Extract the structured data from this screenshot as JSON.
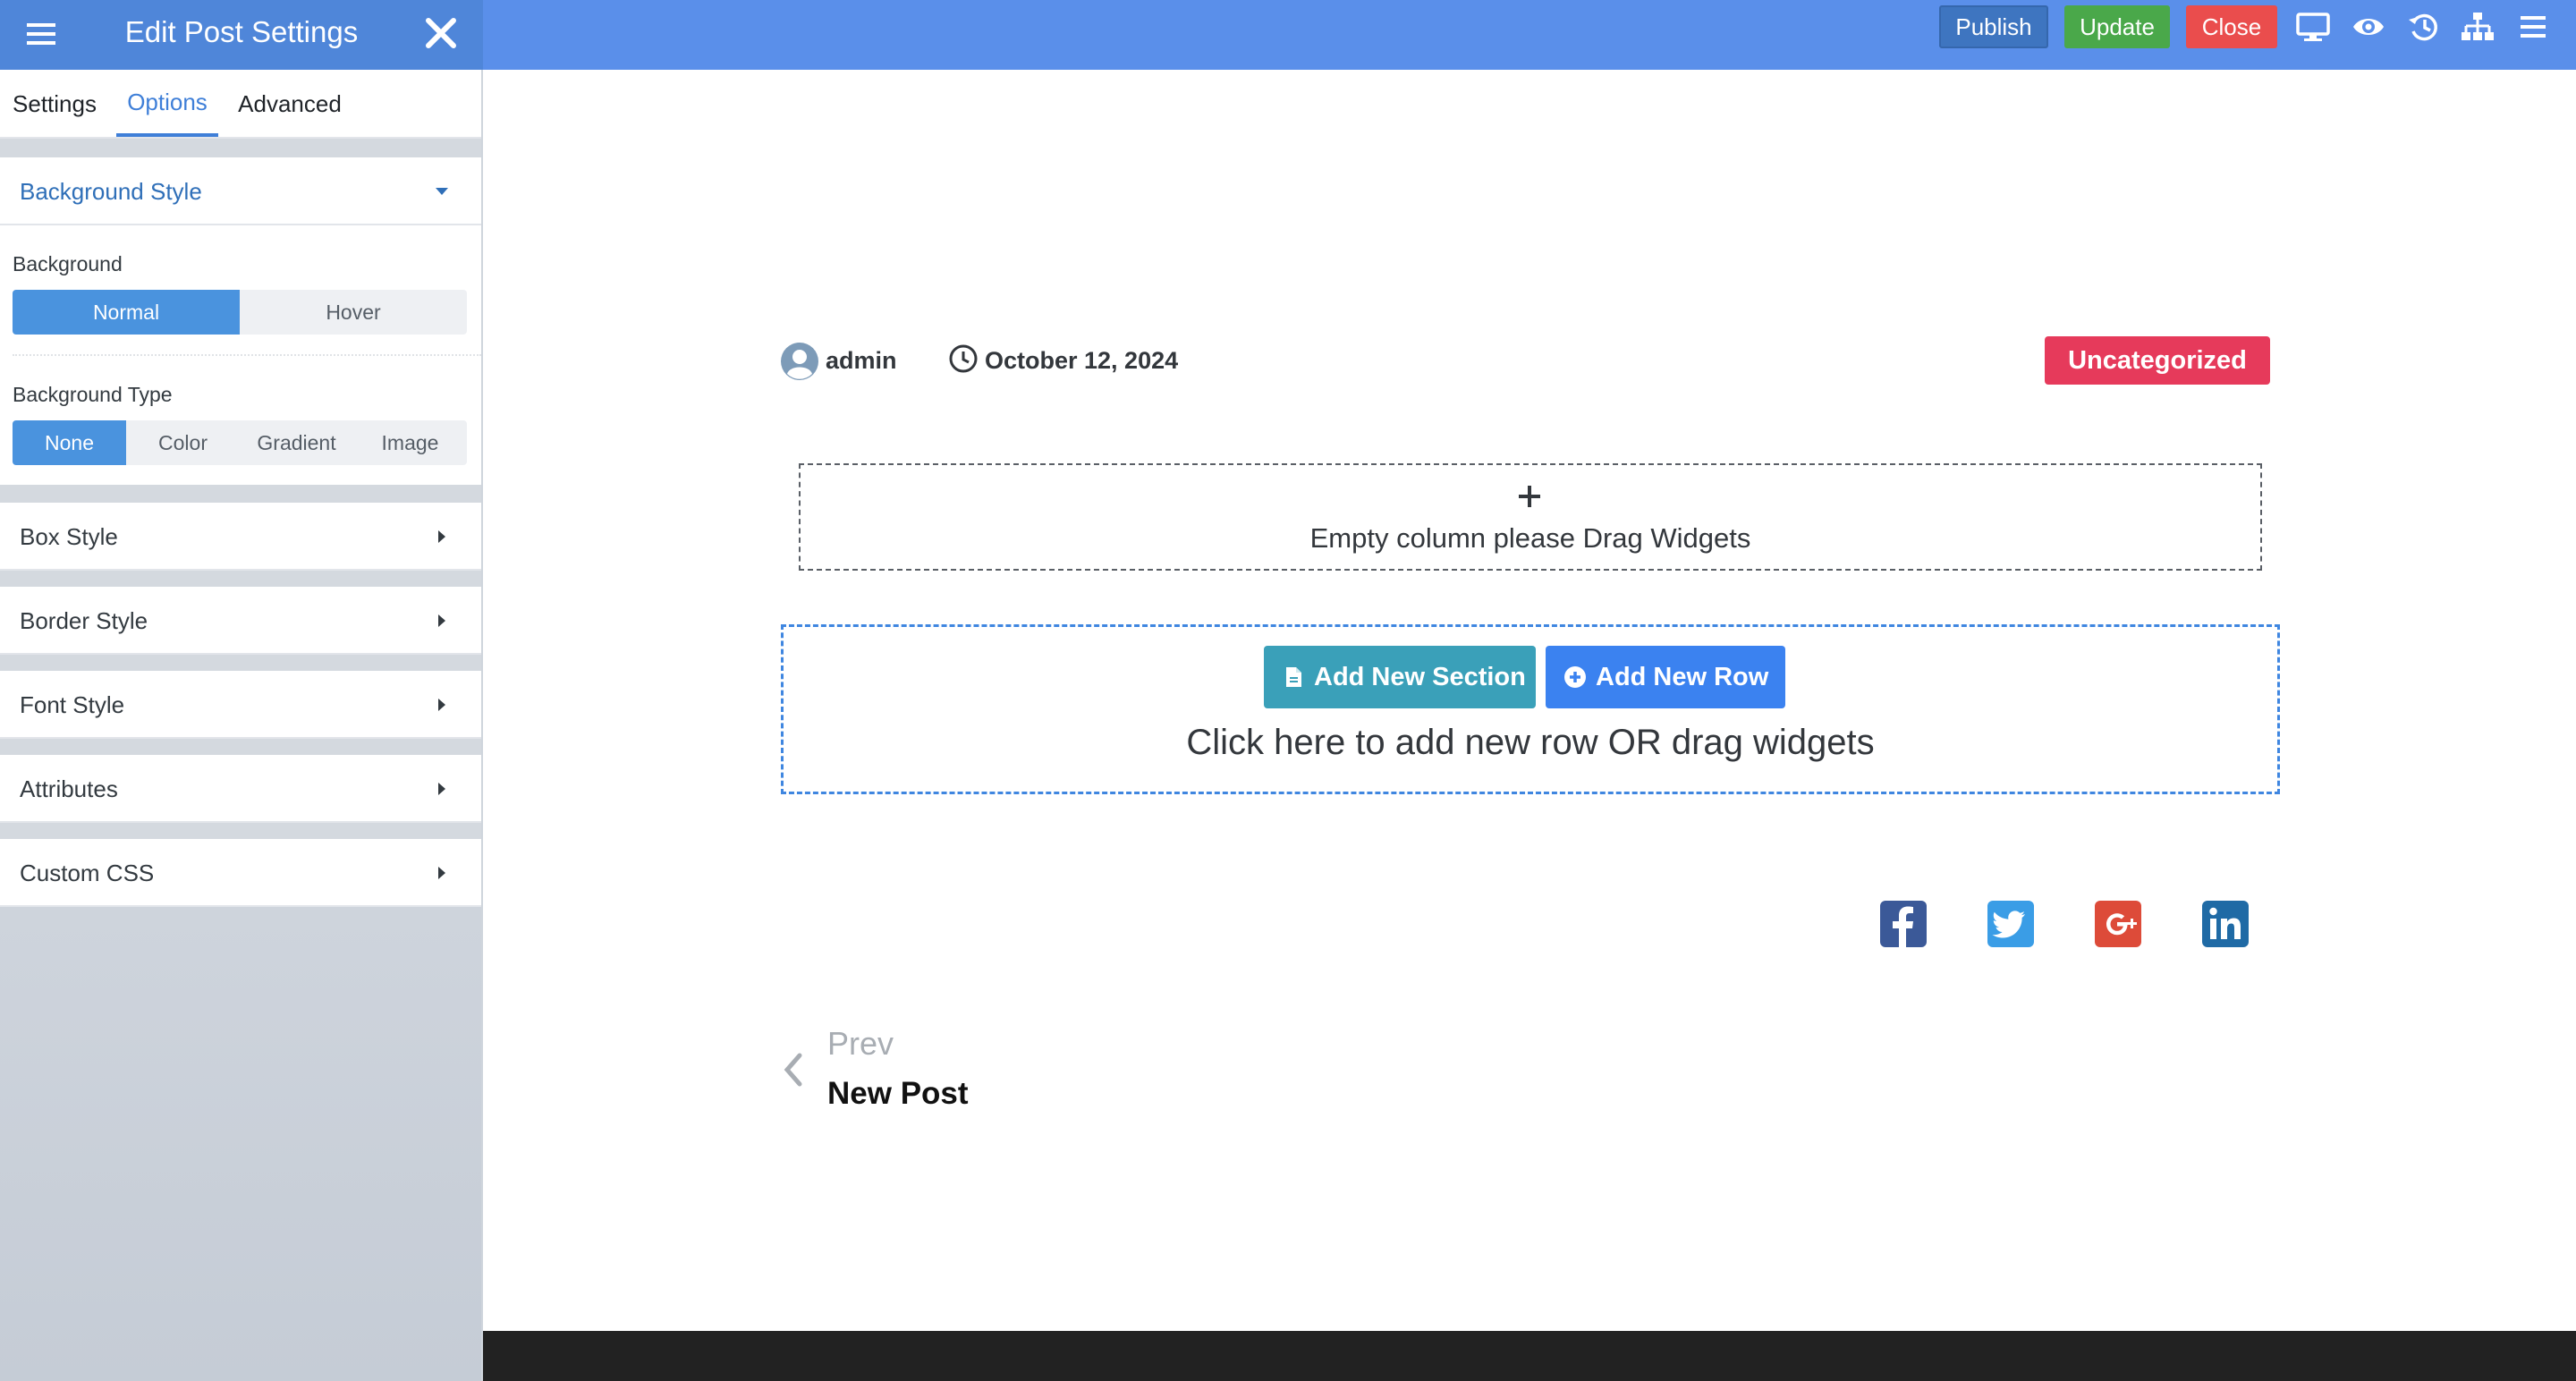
{
  "sidebar": {
    "title": "Edit Post Settings",
    "tabs": [
      {
        "label": "Settings"
      },
      {
        "label": "Options"
      },
      {
        "label": "Advanced"
      }
    ],
    "sections": {
      "background_style": "Background Style",
      "background_label": "Background",
      "background_state": [
        "Normal",
        "Hover"
      ],
      "background_type_label": "Background Type",
      "background_types": [
        "None",
        "Color",
        "Gradient",
        "Image"
      ],
      "box_style": "Box Style",
      "border_style": "Border Style",
      "font_style": "Font Style",
      "attributes": "Attributes",
      "custom_css": "Custom CSS"
    }
  },
  "topbar": {
    "publish": "Publish",
    "update": "Update",
    "close": "Close"
  },
  "post": {
    "author": "admin",
    "date": "October 12, 2024",
    "category": "Uncategorized",
    "empty_column_text": "Empty column please Drag Widgets",
    "add_new_section": "Add New Section",
    "add_new_row": "Add New Row",
    "add_hint": "Click here to add new row OR drag widgets",
    "prev_label": "Prev",
    "prev_title": "New Post"
  },
  "colors": {
    "topbar": "#5a8fea",
    "sidebar_header": "#4f86d9",
    "publish": "#3e75c0",
    "update": "#4aa84a",
    "close": "#ea4d4d",
    "category": "#e63a5b",
    "add_section": "#3aa0b9",
    "add_row": "#3b82f0"
  },
  "icons": {
    "sidebar_menu": "hamburger-icon",
    "sidebar_close": "close-icon",
    "desktop": "desktop-icon",
    "preview": "eye-icon",
    "history": "history-icon",
    "navigator": "sitemap-icon",
    "menu": "hamburger-icon",
    "author": "user-circle-icon",
    "date": "clock-icon",
    "social": [
      "facebook-icon",
      "twitter-icon",
      "google-plus-icon",
      "linkedin-icon"
    ]
  }
}
